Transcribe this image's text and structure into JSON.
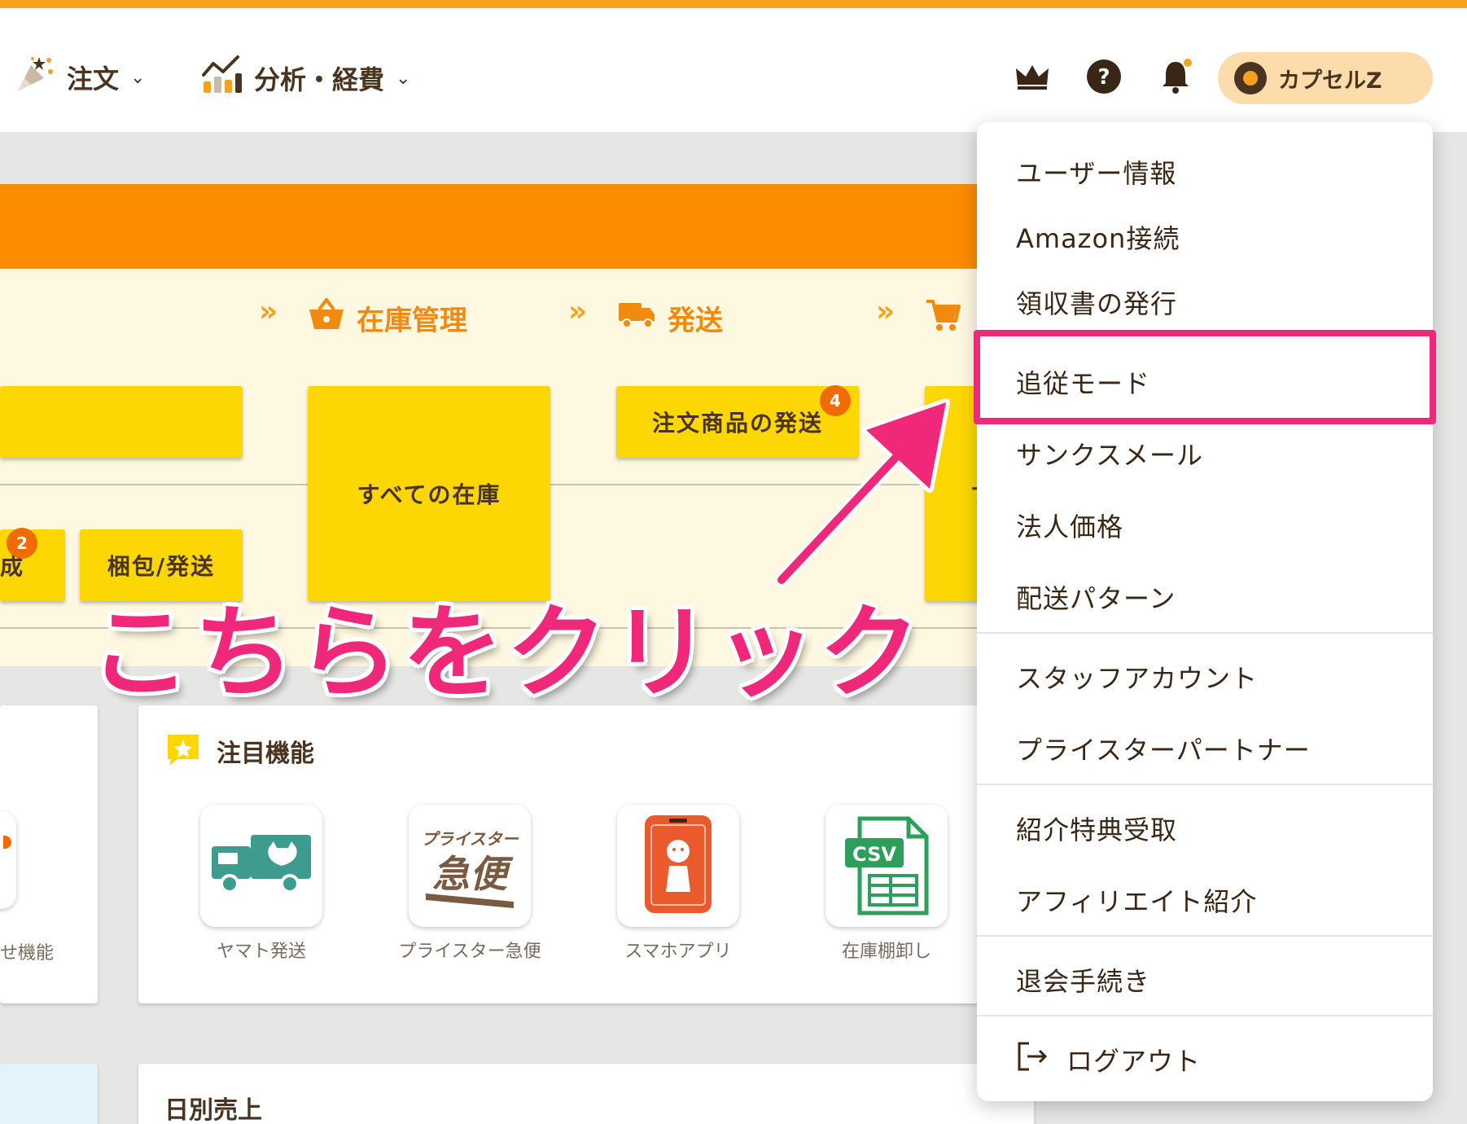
{
  "header": {
    "nav": [
      {
        "label": "注文",
        "icon": "party-popper-icon"
      },
      {
        "label": "分析・経費",
        "icon": "chart-icon"
      }
    ],
    "icons": [
      "crown-icon",
      "help-icon",
      "bell-icon"
    ],
    "user_name": "カプセルZ"
  },
  "flow": {
    "steps": [
      {
        "label": "在庫管理",
        "icon": "basket-icon"
      },
      {
        "label": "発送",
        "icon": "truck-icon"
      },
      {
        "label": "",
        "icon": "cart-icon"
      }
    ]
  },
  "panel": {
    "buttons": [
      {
        "label": "すべての在庫"
      },
      {
        "label": "注文商品の発送",
        "badge": "4"
      },
      {
        "label": "梱包/発送"
      },
      {
        "label": "成",
        "badge": "2"
      },
      {
        "label": "す"
      }
    ]
  },
  "features": {
    "title": "注目機能",
    "left_partial_label": "せ機能",
    "items": [
      {
        "label": "ヤマト発送",
        "icon": "yamato-truck-icon"
      },
      {
        "label": "プライスター急便",
        "icon": "pricestar-kyubin-icon",
        "logo_text": [
          "プライスター",
          "急便"
        ]
      },
      {
        "label": "スマホアプリ",
        "icon": "smartphone-app-icon"
      },
      {
        "label": "在庫棚卸し",
        "icon": "csv-file-icon",
        "logo_text": [
          "CSV"
        ]
      }
    ]
  },
  "daily_sales": {
    "title": "日別売上"
  },
  "menu": {
    "groups": [
      [
        "ユーザー情報",
        "Amazon接続",
        "領収書の発行",
        "追従モード",
        "サンクスメール",
        "法人価格",
        "配送パターン"
      ],
      [
        "スタッフアカウント",
        "プライスターパートナー"
      ],
      [
        "紹介特典受取",
        "アフィリエイト紹介"
      ],
      [
        "退会手続き"
      ],
      [
        "ログアウト"
      ]
    ]
  },
  "annotation": {
    "text": "こちらをクリック",
    "color": "#f0287a"
  },
  "colors": {
    "accent_orange": "#fb8c00",
    "button_yellow": "#fcd703",
    "highlight_pink": "#f0287a",
    "brown": "#4a3420"
  }
}
